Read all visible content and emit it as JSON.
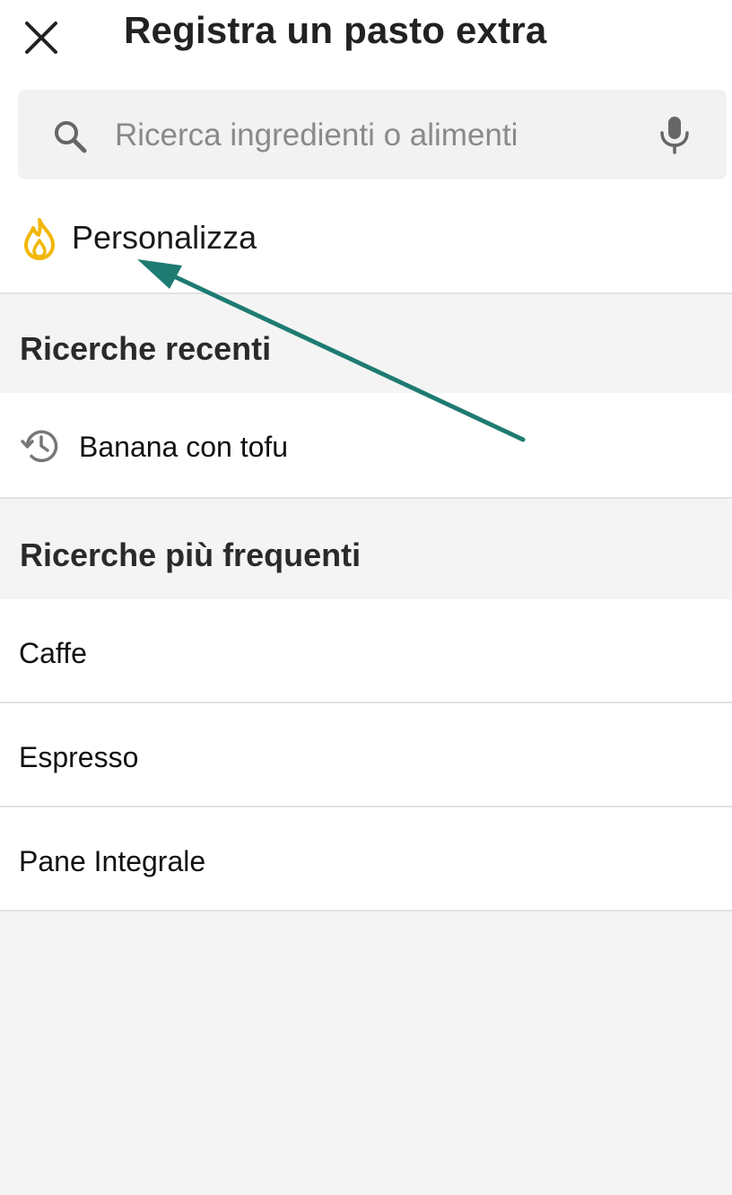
{
  "header": {
    "title": "Registra un pasto extra",
    "close_icon": "close-icon"
  },
  "search": {
    "placeholder": "Ricerca ingredienti o alimenti",
    "value": "",
    "search_icon": "search-icon",
    "mic_icon": "microphone-icon"
  },
  "customize": {
    "label": "Personalizza",
    "icon": "flame-icon",
    "icon_color": "#F2B705"
  },
  "recent": {
    "heading": "Ricerche recenti",
    "items": [
      {
        "label": "Banana con tofu",
        "icon": "history-icon"
      }
    ]
  },
  "frequent": {
    "heading": "Ricerche più frequenti",
    "items": [
      {
        "label": "Caffe"
      },
      {
        "label": "Espresso"
      },
      {
        "label": "Pane Integrale"
      }
    ]
  },
  "colors": {
    "background": "#F4F4F4",
    "surface": "#FFFFFF",
    "search_field": "#F2F2F2",
    "divider": "#E2E2E2",
    "annotation_arrow": "#1E7B72"
  }
}
